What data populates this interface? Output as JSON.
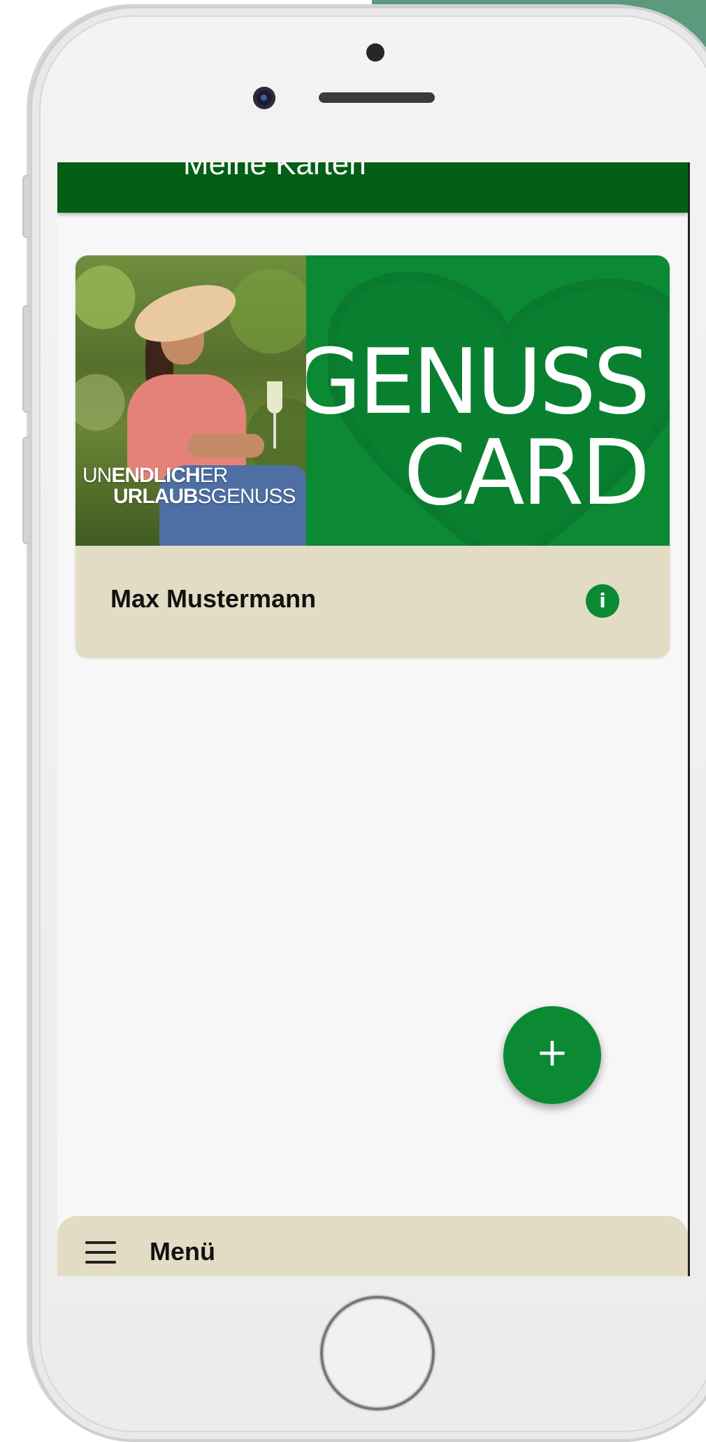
{
  "header": {
    "title": "Meine Karten"
  },
  "card": {
    "slogan": {
      "line1_bold": "ENDLICH",
      "line1_prefix": "UN",
      "line1_suffix": "ER",
      "line2_bold": "URLAUB",
      "line2_suffix": "SGENUSS"
    },
    "brand_line1": "GENUSS",
    "brand_line2": "CARD",
    "holder_name": "Max Mustermann",
    "info_icon": "info-icon",
    "info_glyph": "i"
  },
  "fab": {
    "icon": "plus-icon",
    "glyph": "+"
  },
  "bottom_nav": {
    "menu_icon": "hamburger-menu-icon",
    "menu_label": "Menü"
  },
  "colors": {
    "app_bar": "#045f14",
    "accent_green": "#0b8a33",
    "card_footer": "#e3dcc4",
    "screen_background": "#f7f7f7"
  }
}
